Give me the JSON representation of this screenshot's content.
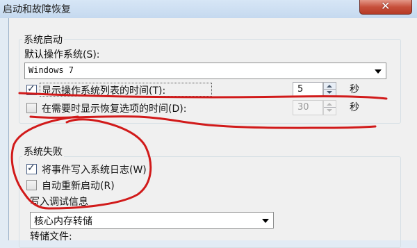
{
  "window": {
    "title": "启动和故障恢复"
  },
  "startup": {
    "group_label": "系统启动",
    "default_os_label": "默认操作系统(S):",
    "default_os_value": "Windows 7",
    "show_os_list_label": "显示操作系统列表的时间(T):",
    "show_os_list_checked": true,
    "show_os_list_value": "5",
    "show_os_list_unit": "秒",
    "show_recovery_label": "在需要时显示恢复选项的时间(D):",
    "show_recovery_checked": false,
    "show_recovery_value": "30",
    "show_recovery_unit": "秒"
  },
  "failure": {
    "group_label": "系统失败",
    "write_event_label": "将事件写入系统日志(W)",
    "write_event_checked": true,
    "auto_restart_label": "自动重新启动(R)",
    "auto_restart_checked": false,
    "debug_info_label": "写入调试信息",
    "debug_info_value": "核心内存转储",
    "dump_file_label": "转储文件:"
  },
  "colors": {
    "annotation": "#d11a1a",
    "title_bar": "#c9dcf0",
    "close_button": "#c7503b"
  },
  "icons": [
    "close-icon",
    "dropdown-arrow-icon",
    "spin-up-icon",
    "spin-down-icon",
    "checkmark-icon"
  ]
}
